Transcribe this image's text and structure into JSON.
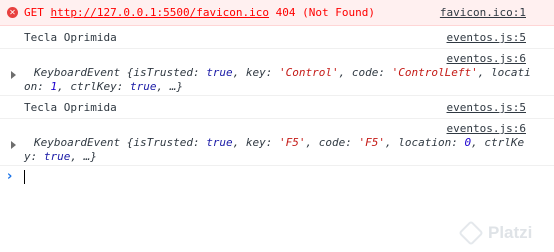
{
  "error": {
    "method": "GET",
    "url": "http://127.0.0.1:5500/favicon.ico",
    "status": "404 (Not Found)",
    "source": "favicon.ico:1"
  },
  "logs": [
    {
      "type": "text",
      "text": "Tecla Oprimida",
      "source": "eventos.js:5"
    },
    {
      "type": "object",
      "source": "eventos.js:6",
      "line1": {
        "prefix": "KeyboardEvent {isTrusted: ",
        "istrusted": "true",
        "k_key": ", key: ",
        "key": "'Control'",
        "k_code": ", code: ",
        "code": "'ControlLeft'",
        "k_loc": ", locati"
      },
      "line2": {
        "prefix": "on: ",
        "location": "1",
        "k_ctrl": ", ctrlKey: ",
        "ctrl": "true",
        "suffix": ", …}"
      }
    },
    {
      "type": "text",
      "text": "Tecla Oprimida",
      "source": "eventos.js:5"
    },
    {
      "type": "object",
      "source": "eventos.js:6",
      "line1": {
        "prefix": "KeyboardEvent {isTrusted: ",
        "istrusted": "true",
        "k_key": ", key: ",
        "key": "'F5'",
        "k_code": ", code: ",
        "code": "'F5'",
        "k_loc": ", location: ",
        "location": "0",
        "k_ctrl": ", ctrlKe"
      },
      "line2": {
        "prefix": "y: ",
        "ctrl": "true",
        "suffix": ", …}"
      }
    }
  ],
  "prompt": {
    "chevron": "›"
  },
  "icons": {
    "error": "error-circle-icon",
    "expand": "expand-triangle-icon"
  },
  "colors": {
    "error_bg": "#fff0f0",
    "error_text": "#ff0000",
    "string": "#c41a16",
    "boolean": "#1a1aa6"
  },
  "watermark": {
    "text": "Platzi"
  }
}
